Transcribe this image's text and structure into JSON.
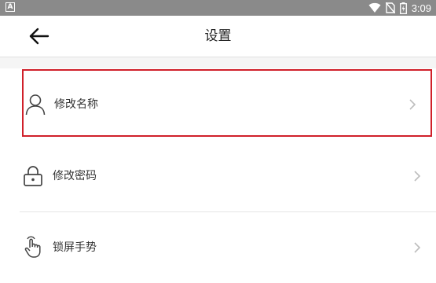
{
  "status_bar": {
    "app_icon": "A",
    "time": "3:09",
    "icons": [
      "wifi-icon",
      "no-sim-icon",
      "battery-charging-icon"
    ]
  },
  "toolbar": {
    "back_icon": "arrow-left-icon",
    "title": "设置"
  },
  "settings": {
    "items": [
      {
        "label": "修改名称",
        "icon": "user-icon",
        "highlighted": true
      },
      {
        "label": "修改密码",
        "icon": "lock-icon",
        "highlighted": false
      },
      {
        "label": "锁屏手势",
        "icon": "gesture-hand-icon",
        "highlighted": false
      }
    ]
  },
  "colors": {
    "status_bar": "#8a8a8a",
    "highlight_border": "#d0202a",
    "divider": "#e6e6e6",
    "text": "#333333"
  }
}
